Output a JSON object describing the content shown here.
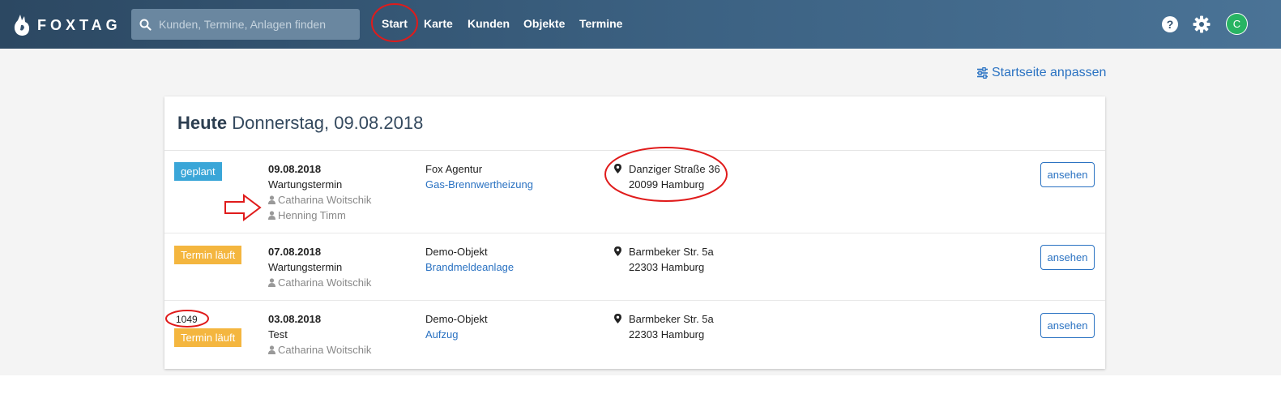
{
  "app": {
    "logo_text": "FOXTAG"
  },
  "search": {
    "placeholder": "Kunden, Termine, Anlagen finden"
  },
  "nav": {
    "items": [
      "Start",
      "Karte",
      "Kunden",
      "Objekte",
      "Termine"
    ]
  },
  "user": {
    "initial": "C"
  },
  "colors": {
    "topbar": "#34526f",
    "accent": "#2a72c2",
    "planned": "#3aa6d8",
    "running": "#f4b63f",
    "avatar": "#28b463"
  },
  "page": {
    "customize_label": "Startseite anpassen",
    "today_label": "Heute",
    "today_date": "Donnerstag, 09.08.2018"
  },
  "rows": [
    {
      "id": "",
      "status": "geplant",
      "date": "09.08.2018",
      "type": "Wartungstermin",
      "people": [
        "Catharina Woitschik",
        "Henning Timm"
      ],
      "object": "Fox Agentur",
      "system": "Gas-Brennwertheizung",
      "street": "Danziger Straße 36",
      "city": "20099 Hamburg",
      "action": "ansehen"
    },
    {
      "id": "",
      "status": "Termin läuft",
      "date": "07.08.2018",
      "type": "Wartungstermin",
      "people": [
        "Catharina Woitschik"
      ],
      "object": "Demo-Objekt",
      "system": "Brandmeldeanlage",
      "street": "Barmbeker Str. 5a",
      "city": "22303 Hamburg",
      "action": "ansehen"
    },
    {
      "id": "1049",
      "status": "Termin läuft",
      "date": "03.08.2018",
      "type": "Test",
      "people": [
        "Catharina Woitschik"
      ],
      "object": "Demo-Objekt",
      "system": "Aufzug",
      "street": "Barmbeker Str. 5a",
      "city": "22303 Hamburg",
      "action": "ansehen"
    }
  ]
}
